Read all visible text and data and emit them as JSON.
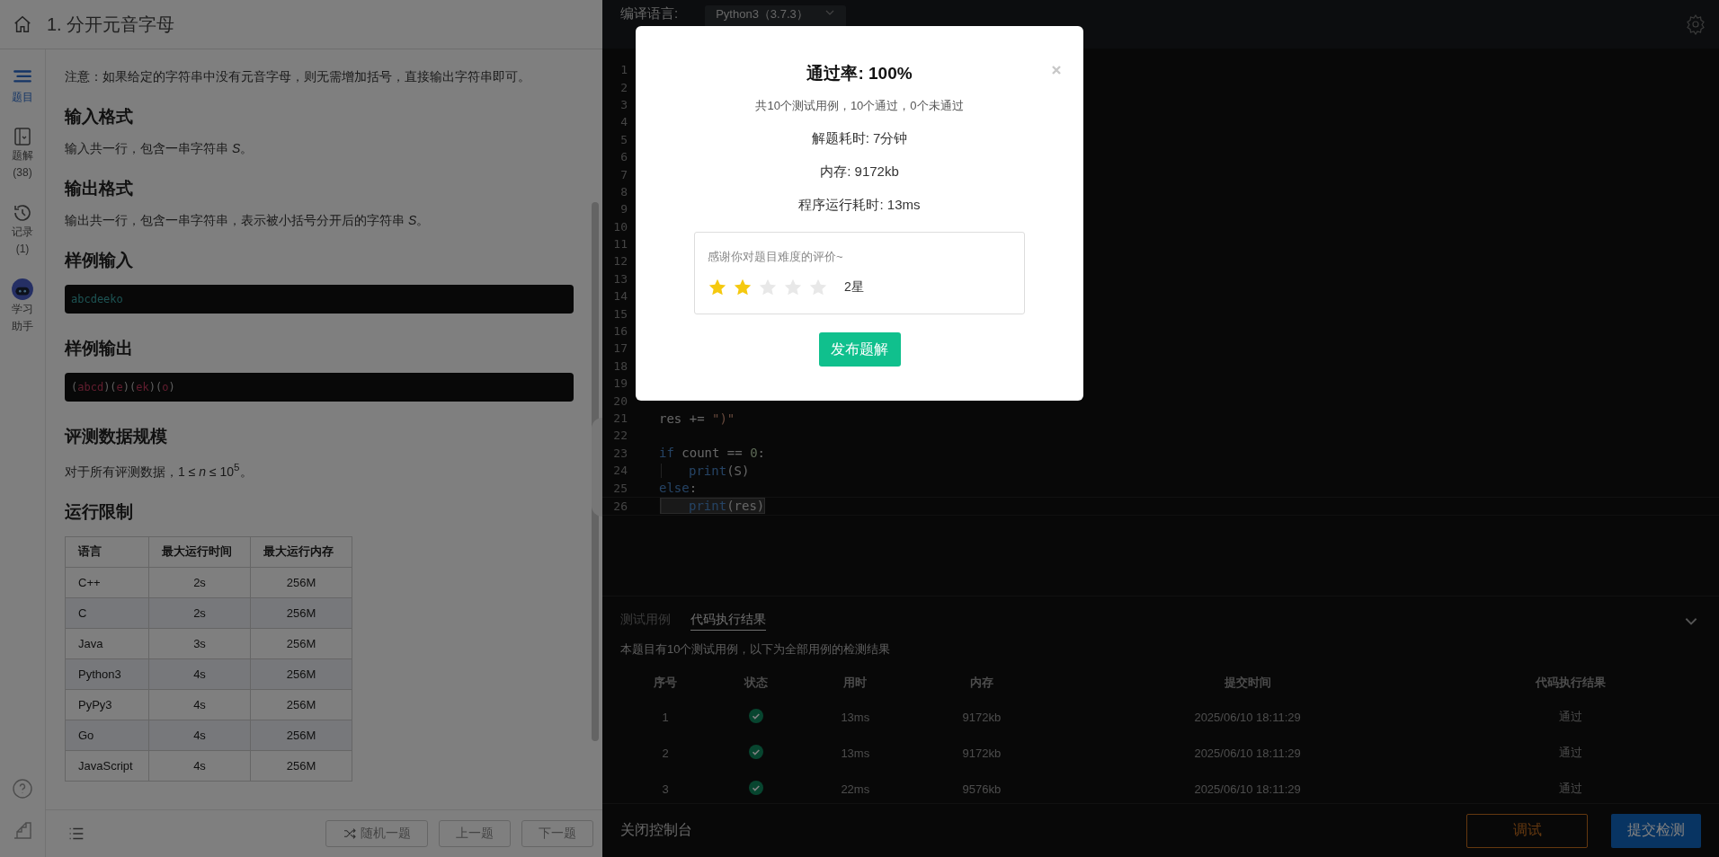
{
  "problem": {
    "title": "1. 分开元音字母",
    "blocks": [
      {
        "kind": "paragraph",
        "text": "注意：如果给定的字符串中没有元音字母，则无需增加括号，直接输出字符串即可。"
      },
      {
        "kind": "heading",
        "text": "输入格式"
      },
      {
        "kind": "paragraph",
        "text": "输入共一行，包含一串字符串 *S*。"
      },
      {
        "kind": "heading",
        "text": "输出格式"
      },
      {
        "kind": "paragraph",
        "text": "输出共一行，包含一串字符串，表示被小括号分开后的字符串 *S*。"
      },
      {
        "kind": "heading",
        "text": "样例输入"
      },
      {
        "kind": "code",
        "tokens": [
          {
            "text": "abcdeeko",
            "kind": "value"
          }
        ]
      },
      {
        "kind": "heading",
        "text": "样例输出"
      },
      {
        "kind": "code",
        "tokens": [
          {
            "text": "(",
            "kind": "punct"
          },
          {
            "text": "abcd",
            "kind": "str"
          },
          {
            "text": ")(",
            "kind": "punct"
          },
          {
            "text": "e",
            "kind": "str"
          },
          {
            "text": ")(",
            "kind": "punct"
          },
          {
            "text": "ek",
            "kind": "str"
          },
          {
            "text": ")(",
            "kind": "punct"
          },
          {
            "text": "o",
            "kind": "str"
          },
          {
            "text": ")",
            "kind": "punct"
          }
        ]
      },
      {
        "kind": "heading",
        "text": "评测数据规模"
      },
      {
        "kind": "paragraph",
        "text": "对于所有评测数据，1 ≤ *n* ≤ 10$^{5}$。"
      },
      {
        "kind": "heading",
        "text": "运行限制"
      },
      {
        "kind": "table",
        "columns": [
          "语言",
          "最大运行时间",
          "最大运行内存"
        ],
        "rows": [
          [
            "C++",
            "2s",
            "256M"
          ],
          [
            "C",
            "2s",
            "256M"
          ],
          [
            "Java",
            "3s",
            "256M"
          ],
          [
            "Python3",
            "4s",
            "256M"
          ],
          [
            "PyPy3",
            "4s",
            "256M"
          ],
          [
            "Go",
            "4s",
            "256M"
          ],
          [
            "JavaScript",
            "4s",
            "256M"
          ]
        ]
      }
    ]
  },
  "sidebar": {
    "items": [
      {
        "label": "题目",
        "kind": "list",
        "selected": true
      },
      {
        "label": "题解",
        "count": "(38)",
        "kind": "book",
        "selected": false
      },
      {
        "label": "记录",
        "count": "(1)",
        "kind": "history",
        "selected": false
      },
      {
        "label": "学习助手",
        "kind": "robot",
        "selected": false
      }
    ]
  },
  "footer": {
    "buttons": [
      {
        "label": "随机一题",
        "kind": "random"
      },
      {
        "label": "上一题",
        "kind": "plain"
      },
      {
        "label": "下一题",
        "kind": "plain"
      }
    ]
  },
  "editor": {
    "language_label": "编译语言:",
    "language": "Python3（3.7.3）",
    "lines": [
      {
        "number": "1"
      },
      {
        "number": "2"
      },
      {
        "number": "3"
      },
      {
        "number": "4"
      },
      {
        "number": "5"
      },
      {
        "number": "6"
      },
      {
        "number": "7"
      },
      {
        "number": "8"
      },
      {
        "number": "9"
      },
      {
        "number": "10"
      },
      {
        "number": "11"
      },
      {
        "number": "12"
      },
      {
        "number": "13"
      },
      {
        "number": "14"
      },
      {
        "number": "15"
      },
      {
        "number": "16"
      },
      {
        "number": "17"
      },
      {
        "number": "18"
      },
      {
        "number": "19"
      },
      {
        "number": "20"
      },
      {
        "number": "21",
        "tokens": [
          {
            "text": "res += ",
            "kind": "var"
          },
          {
            "text": "\")\"",
            "kind": "str"
          }
        ]
      },
      {
        "number": "22"
      },
      {
        "number": "23",
        "tokens": [
          {
            "text": "if",
            "kind": "kw"
          },
          {
            "text": " count == ",
            "kind": "var"
          },
          {
            "text": "0",
            "kind": "num"
          },
          {
            "text": ":",
            "kind": "var"
          }
        ]
      },
      {
        "number": "24",
        "indent": true,
        "tokens": [
          {
            "text": "print",
            "kind": "fn"
          },
          {
            "text": "(S)",
            "kind": "var"
          }
        ]
      },
      {
        "number": "25",
        "tokens": [
          {
            "text": "else",
            "kind": "kw"
          },
          {
            "text": ":",
            "kind": "var"
          }
        ]
      },
      {
        "number": "26",
        "indent": true,
        "current": true,
        "tokens": [
          {
            "text": "print",
            "kind": "fn"
          },
          {
            "text": "(res)",
            "kind": "var"
          }
        ]
      }
    ]
  },
  "console": {
    "tabs": [
      {
        "label": "测试用例",
        "selected": false
      },
      {
        "label": "代码执行结果",
        "selected": true
      }
    ],
    "summary": "本题目有10个测试用例，以下为全部用例的检测结果",
    "columns": [
      "序号",
      "状态",
      "用时",
      "内存",
      "提交时间",
      "代码执行结果"
    ],
    "rows": [
      {
        "index": "1",
        "kind": "pass",
        "time": "13ms",
        "memory": "9172kb",
        "submitted": "2025/06/10 18:11:29",
        "result": "通过"
      },
      {
        "index": "2",
        "kind": "pass",
        "time": "13ms",
        "memory": "9172kb",
        "submitted": "2025/06/10 18:11:29",
        "result": "通过"
      },
      {
        "index": "3",
        "kind": "pass",
        "time": "22ms",
        "memory": "9576kb",
        "submitted": "2025/06/10 18:11:29",
        "result": "通过"
      }
    ],
    "close_label": "关闭控制台",
    "debug_button": "调试",
    "submit_button": "提交检测"
  },
  "modal": {
    "title": "通过率: 100%",
    "subtitle": "共10个测试用例，10个通过，0个未通过",
    "stats": [
      "解题耗时: 7分钟",
      "内存: 9172kb",
      "程序运行耗时: 13ms"
    ],
    "rating": {
      "prompt": "感谢你对题目难度的评价~",
      "stars": 2,
      "label": "2星"
    },
    "button": "发布题解"
  }
}
